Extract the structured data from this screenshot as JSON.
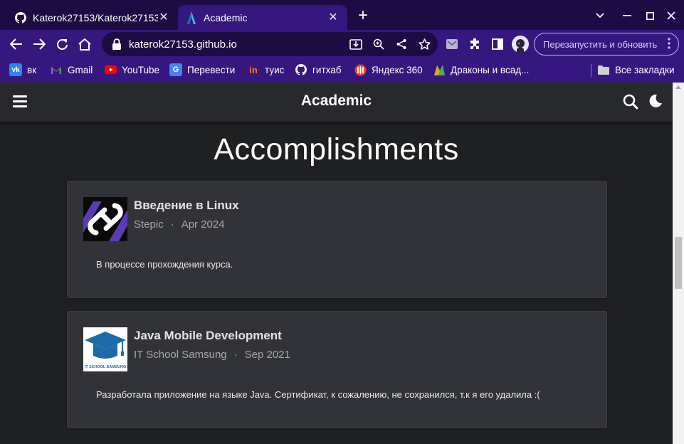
{
  "browser": {
    "tabs": [
      {
        "title": "Katerok27153/Katerok27153",
        "icon": "github-icon",
        "active": false
      },
      {
        "title": "Academic",
        "icon": "academic-icon",
        "active": true
      }
    ],
    "url": "katerok27153.github.io",
    "relaunch_label": "Перезапустить и обновить",
    "bookmarks": [
      {
        "label": "вк",
        "icon": "vk-icon"
      },
      {
        "label": "Gmail",
        "icon": "gmail-icon"
      },
      {
        "label": "YouTube",
        "icon": "youtube-icon"
      },
      {
        "label": "Перевести",
        "icon": "translate-icon"
      },
      {
        "label": "туис",
        "icon": "tuis-icon"
      },
      {
        "label": "гитхаб",
        "icon": "github-icon"
      },
      {
        "label": "Яндекс 360",
        "icon": "yandex360-icon"
      },
      {
        "label": "Драконы и всад...",
        "icon": "dragons-icon"
      }
    ],
    "all_bookmarks_label": "Все закладки",
    "colors": {
      "frame": "#35177f",
      "tabstrip": "#1d0b44"
    }
  },
  "site": {
    "brand": "Academic",
    "section_title": "Accomplishments",
    "accomplishments": [
      {
        "title": "Введение в Linux",
        "organization": "Stepic",
        "date": "Apr 2024",
        "description": "В процессе прохождения курса."
      },
      {
        "title": "Java Mobile Development",
        "organization": "IT School Samsung",
        "date": "Sep 2021",
        "description": "Разработала приложение на языке Java. Сертификат, к сожалению, не сохранился, т.к я его удалила :(",
        "logo_text": "IT SCHOOL SAMSUNG"
      }
    ]
  }
}
